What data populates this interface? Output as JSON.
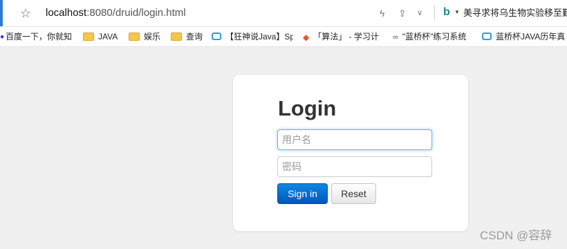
{
  "browser": {
    "url_host": "localhost",
    "url_rest": ":8080/druid/login.html",
    "star_icon": "star-icon",
    "news_text": "美寻求将乌生物实验移至觐"
  },
  "bookmarks": [
    {
      "label": "百度一下，你就知",
      "icon": "paw-icon"
    },
    {
      "label": "JAVA",
      "icon": "folder-icon"
    },
    {
      "label": "娱乐",
      "icon": "folder-icon"
    },
    {
      "label": "查询",
      "icon": "folder-icon"
    },
    {
      "label": "【狂神说Java】Sp",
      "icon": "bilibili-icon"
    },
    {
      "label": "「算法」 - 学习计",
      "icon": "flame-icon"
    },
    {
      "label": "\"蓝桥杯\"练习系统",
      "icon": "mooc-icon"
    },
    {
      "label": "蓝桥杯JAVA历年真",
      "icon": "bilibili-icon"
    }
  ],
  "login": {
    "title": "Login",
    "username_placeholder": "用户名",
    "password_placeholder": "密码",
    "signin_label": "Sign in",
    "reset_label": "Reset"
  },
  "watermark": "CSDN @容辞",
  "colors": {
    "primary": "#0a6fd1",
    "background": "#f0f0f0",
    "focus_border": "#6fb0e6"
  }
}
